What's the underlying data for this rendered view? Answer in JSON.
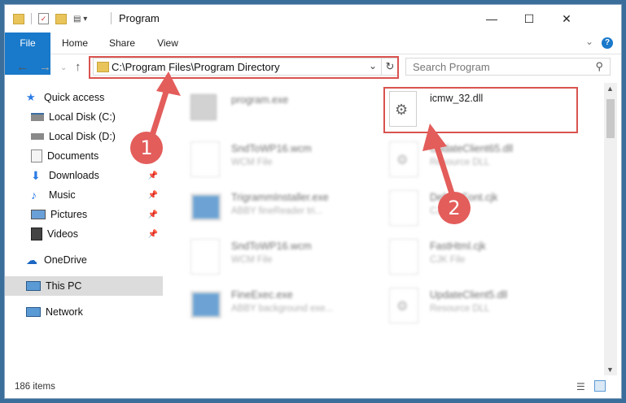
{
  "window": {
    "title": "Program",
    "controls": {
      "minimize": "—",
      "maximize": "☐",
      "close": "✕"
    }
  },
  "ribbon": {
    "tabs": [
      "File",
      "Home",
      "Share",
      "View"
    ],
    "expand": "⌄",
    "help": "?"
  },
  "address": {
    "path": "C:\\Program Files\\Program Directory",
    "search_placeholder": "Search Program"
  },
  "nav": {
    "items": [
      {
        "label": "Quick access",
        "icon": "star-icon"
      },
      {
        "label": "Local Disk (C:)",
        "icon": "drive-icon"
      },
      {
        "label": "Local Disk (D:)",
        "icon": "drive-icon"
      },
      {
        "label": "Documents",
        "icon": "documents-icon"
      },
      {
        "label": "Downloads",
        "icon": "downloads-icon"
      },
      {
        "label": "Music",
        "icon": "music-icon"
      },
      {
        "label": "Pictures",
        "icon": "pictures-icon"
      },
      {
        "label": "Videos",
        "icon": "videos-icon"
      },
      {
        "label": "OneDrive",
        "icon": "cloud-icon"
      },
      {
        "label": "This PC",
        "icon": "computer-icon"
      },
      {
        "label": "Network",
        "icon": "network-icon"
      }
    ]
  },
  "files": [
    {
      "name": "program.exe",
      "type": ""
    },
    {
      "name": "icmw_32.dll",
      "type": ""
    },
    {
      "name": "SndToWP16.wcm",
      "type": "WCM File"
    },
    {
      "name": "UpdateClient65.dll",
      "type": "Resource DLL"
    },
    {
      "name": "TrigrammInstaller.exe",
      "type": "ABBY fineReader tri..."
    },
    {
      "name": "DefaultFont.cjk",
      "type": "CJK File"
    },
    {
      "name": "SndToWP16.wcm",
      "type": "WCM File"
    },
    {
      "name": "FastHtml.cjk",
      "type": "CJK File"
    },
    {
      "name": "FineExec.exe",
      "type": "ABBY background exe..."
    },
    {
      "name": "UpdateClient5.dll",
      "type": "Resource DLL"
    }
  ],
  "status": {
    "count": "186 items"
  },
  "annotations": {
    "marker1": "1",
    "marker2": "2"
  },
  "colors": {
    "accent": "#1979ca",
    "highlight": "#d9534f",
    "marker": "#e35d5b"
  }
}
